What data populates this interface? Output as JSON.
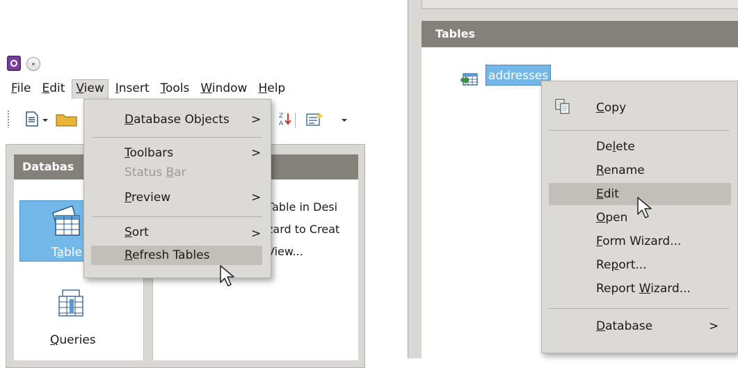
{
  "left_window": {
    "menubar": [
      {
        "pre": "",
        "key": "F",
        "post": "ile"
      },
      {
        "pre": "",
        "key": "E",
        "post": "dit"
      },
      {
        "pre": "",
        "key": "V",
        "post": "iew"
      },
      {
        "pre": "",
        "key": "I",
        "post": "nsert"
      },
      {
        "pre": "",
        "key": "T",
        "post": "ools"
      },
      {
        "pre": "",
        "key": "W",
        "post": "indow"
      },
      {
        "pre": "",
        "key": "H",
        "post": "elp"
      }
    ],
    "database_header": "Databas",
    "sidebar": {
      "tables_label_a": "T",
      "tables_label_u": "a",
      "tables_label_b": "ble",
      "queries_label_u": "Q",
      "queries_label_b": "ueries"
    },
    "tasks": [
      "Table in Desi",
      "zard to Creat",
      "View..."
    ],
    "view_menu": {
      "database_objects": {
        "pre": "",
        "key": "D",
        "post": "atabase Objects"
      },
      "toolbars": {
        "pre": "",
        "key": "T",
        "post": "oolbars"
      },
      "status_bar": {
        "pre": "Status ",
        "key": "B",
        "post": "ar"
      },
      "preview": {
        "pre": "",
        "key": "P",
        "post": "review"
      },
      "sort": {
        "pre": "",
        "key": "S",
        "post": "ort"
      },
      "refresh_tables": {
        "pre": "",
        "key": "R",
        "post": "efresh Tables"
      },
      "arrow": ">"
    }
  },
  "right_window": {
    "tables_header": "Tables",
    "table_name": "addresses",
    "context_menu": {
      "copy": {
        "pre": "",
        "key": "C",
        "post": "opy"
      },
      "delete": {
        "pre": "De",
        "key": "l",
        "post": "ete"
      },
      "rename": {
        "pre": "",
        "key": "R",
        "post": "ename"
      },
      "edit": {
        "pre": "",
        "key": "E",
        "post": "dit"
      },
      "open": {
        "pre": "",
        "key": "O",
        "post": "pen"
      },
      "form_wizard": {
        "pre": "",
        "key": "F",
        "post": "orm Wizard..."
      },
      "report": {
        "pre": "Re",
        "key": "p",
        "post": "ort..."
      },
      "report_wizard": {
        "pre": "Report ",
        "key": "W",
        "post": "izard..."
      },
      "database": {
        "pre": "",
        "key": "D",
        "post": "atabase"
      },
      "arrow": ">"
    }
  },
  "colors": {
    "menu_bg": "#dcdad6",
    "highlight": "#c2bfba",
    "selection_blue": "#74b8ea",
    "header_gray": "#84817b"
  }
}
